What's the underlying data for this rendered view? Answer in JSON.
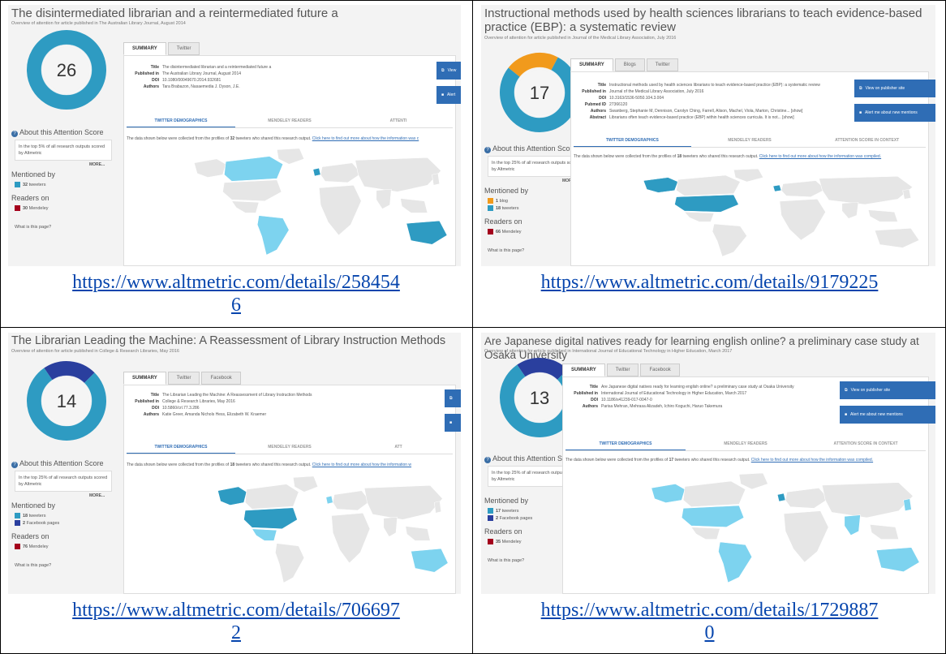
{
  "cells": [
    {
      "title": "The disintermediated librarian and a reintermediated future a",
      "subtitle": "Overview of attention for article published in The Australian Library Journal, August 2014",
      "score": "26",
      "tabs": [
        "SUMMARY",
        "Twitter"
      ],
      "meta": [
        {
          "k": "Title",
          "v": "The disintermediated librarian and a reintermediated future a"
        },
        {
          "k": "Published in",
          "v": "The Australian Library Journal, August 2014"
        },
        {
          "k": "DOI",
          "v": "10.1080/00049670.2014.932681"
        },
        {
          "k": "Authors",
          "v": "Tara Brabazon, Nasaemedia J. Dyson, J.E."
        }
      ],
      "buttons": [
        "View",
        "Alert"
      ],
      "subtabs": [
        "TWITTER DEMOGRAPHICS",
        "MENDELEY READERS",
        "ATTENTI"
      ],
      "note_pre": "The data shown below were collected from the profiles of ",
      "note_num": "32",
      "note_mid": " tweeters who shared this research output. ",
      "note_link": "Click here to find out more about how the information was c",
      "about": "About this Attention Score",
      "top_text": "In the top 5% of all research outputs scored by Altmetric",
      "more": "MORE...",
      "mentioned_by": "Mentioned by",
      "mentions": [
        {
          "count": "32",
          "label": "tweeters",
          "color": "#2e9bc2"
        }
      ],
      "readers_on": "Readers on",
      "readers": [
        {
          "count": "30",
          "label": "Mendeley",
          "color": "#a4001c"
        }
      ],
      "what": "What is this page?",
      "url": [
        "https://www.altmetric.com/details/258454",
        "6"
      ]
    },
    {
      "title": "Instructional methods used by health sciences librarians to teach evidence-based practice (EBP): a systematic review",
      "subtitle": "Overview of attention for article published in Journal of the Medical Library Association, July 2016",
      "score": "17",
      "tabs": [
        "SUMMARY",
        "Blogs",
        "Twitter"
      ],
      "meta": [
        {
          "k": "Title",
          "v": "Instructional methods used by health sciences librarians to teach evidence-based practice (EBP): a systematic review"
        },
        {
          "k": "Published in",
          "v": "Journal of the Medical Library Association, July 2016"
        },
        {
          "k": "DOI",
          "v": "10.3163/1536-5050.104.3.004"
        },
        {
          "k": "Pubmed ID",
          "v": "27366120"
        },
        {
          "k": "Authors",
          "v": "Swanberg, Stephanie M, Dennison, Carolyn Ching, Farrell, Alison, Machel, Viola, Marton, Christine... [show]"
        },
        {
          "k": "Abstract",
          "v": "Librarians often teach evidence-based practice (EBP) within health sciences curricula. It is not... [show]"
        }
      ],
      "buttons": [
        "View on publisher site",
        "Alert me about new mentions"
      ],
      "subtabs": [
        "TWITTER DEMOGRAPHICS",
        "MENDELEY READERS",
        "ATTENTION SCORE IN CONTEXT"
      ],
      "note_pre": "The data shown below were collected from the profiles of ",
      "note_num": "18",
      "note_mid": " tweeters who shared this research output. ",
      "note_link": "Click here to find out more about how the information was compiled.",
      "about": "About this Attention Score",
      "top_text": "In the top 25% of all research outputs scored by Altmetric",
      "more": "MORE...",
      "mentioned_by": "Mentioned by",
      "mentions": [
        {
          "count": "1",
          "label": "blog",
          "color": "#f19a1c"
        },
        {
          "count": "18",
          "label": "tweeters",
          "color": "#2e9bc2"
        }
      ],
      "readers_on": "Readers on",
      "readers": [
        {
          "count": "66",
          "label": "Mendeley",
          "color": "#a4001c"
        }
      ],
      "what": "What is this page?",
      "url": [
        "https://www.altmetric.com/details/9179225"
      ]
    },
    {
      "title": "The Librarian Leading the Machine: A Reassessment of Library Instruction Methods",
      "subtitle": "Overview of attention for article published in College & Research Libraries, May 2016",
      "score": "14",
      "tabs": [
        "SUMMARY",
        "Twitter",
        "Facebook"
      ],
      "meta": [
        {
          "k": "Title",
          "v": "The Librarian Leading the Machine: A Reassessment of Library Instruction Methods"
        },
        {
          "k": "Published in",
          "v": "College & Research Libraries, May 2016"
        },
        {
          "k": "DOI",
          "v": "10.5860/crl.77.3.286"
        },
        {
          "k": "Authors",
          "v": "Katie Greer, Amanda Nichols Hess, Elizabeth W. Kraemer"
        }
      ],
      "buttons": [
        "",
        ""
      ],
      "subtabs": [
        "TWITTER DEMOGRAPHICS",
        "MENDELEY READERS",
        "ATT"
      ],
      "note_pre": "The data shown below were collected from the profiles of ",
      "note_num": "18",
      "note_mid": " tweeters who shared this research output. ",
      "note_link": "Click here to find out more about how the information w",
      "about": "About this Attention Score",
      "top_text": "In the top 25% of all research outputs scored by Altmetric",
      "more": "MORE...",
      "mentioned_by": "Mentioned by",
      "mentions": [
        {
          "count": "18",
          "label": "tweeters",
          "color": "#2e9bc2"
        },
        {
          "count": "2",
          "label": "Facebook pages",
          "color": "#2a3f9e"
        }
      ],
      "readers_on": "Readers on",
      "readers": [
        {
          "count": "76",
          "label": "Mendeley",
          "color": "#a4001c"
        }
      ],
      "what": "What is this page?",
      "url": [
        "https://www.altmetric.com/details/706697",
        "2"
      ]
    },
    {
      "title": "Are Japanese digital natives ready for learning english online? a preliminary case study at Osaka University",
      "subtitle": "Overview of attention for article published in International Journal of Educational Technology in Higher Education, March 2017",
      "score": "13",
      "tabs": [
        "SUMMARY",
        "Twitter",
        "Facebook"
      ],
      "meta": [
        {
          "k": "Title",
          "v": "Are Japanese digital natives ready for learning english online? a preliminary case study at Osaka University"
        },
        {
          "k": "Published in",
          "v": "International Journal of Educational Technology in Higher Education, March 2017"
        },
        {
          "k": "DOI",
          "v": "10.1186/s41239-017-0047-0"
        },
        {
          "k": "Authors",
          "v": "Parisa Mehran, Mehrasa Alizadeh, Ichiro Koguchi, Haruo Takemura"
        }
      ],
      "buttons": [
        "View on publisher site",
        "Alert me about new mentions"
      ],
      "subtabs": [
        "TWITTER DEMOGRAPHICS",
        "MENDELEY READERS",
        "ATTENTION SCORE IN CONTEXT"
      ],
      "note_pre": "The data shown below were collected from the profiles of ",
      "note_num": "17",
      "note_mid": " tweeters who shared this research output. ",
      "note_link": "Click here to find out more about how the information was compiled.",
      "about": "About this Attention Score",
      "top_text": "In the top 25% of all research outputs scored by Altmetric",
      "more": "MORE...",
      "mentioned_by": "Mentioned by",
      "mentions": [
        {
          "count": "17",
          "label": "tweeters",
          "color": "#2e9bc2"
        },
        {
          "count": "2",
          "label": "Facebook pages",
          "color": "#2a3f9e"
        }
      ],
      "readers_on": "Readers on",
      "readers": [
        {
          "count": "35",
          "label": "Mendeley",
          "color": "#a4001c"
        }
      ],
      "what": "What is this page?",
      "url": [
        "https://www.altmetric.com/details/1729887",
        "0"
      ]
    }
  ],
  "colors": {
    "twitter": "#2e9bc2",
    "twitter_light": "#7dd3ef",
    "map_land": "#e6e6e6",
    "blog": "#f19a1c",
    "facebook": "#2a3f9e",
    "mendeley": "#a4001c",
    "accent": "#2f6db5"
  }
}
